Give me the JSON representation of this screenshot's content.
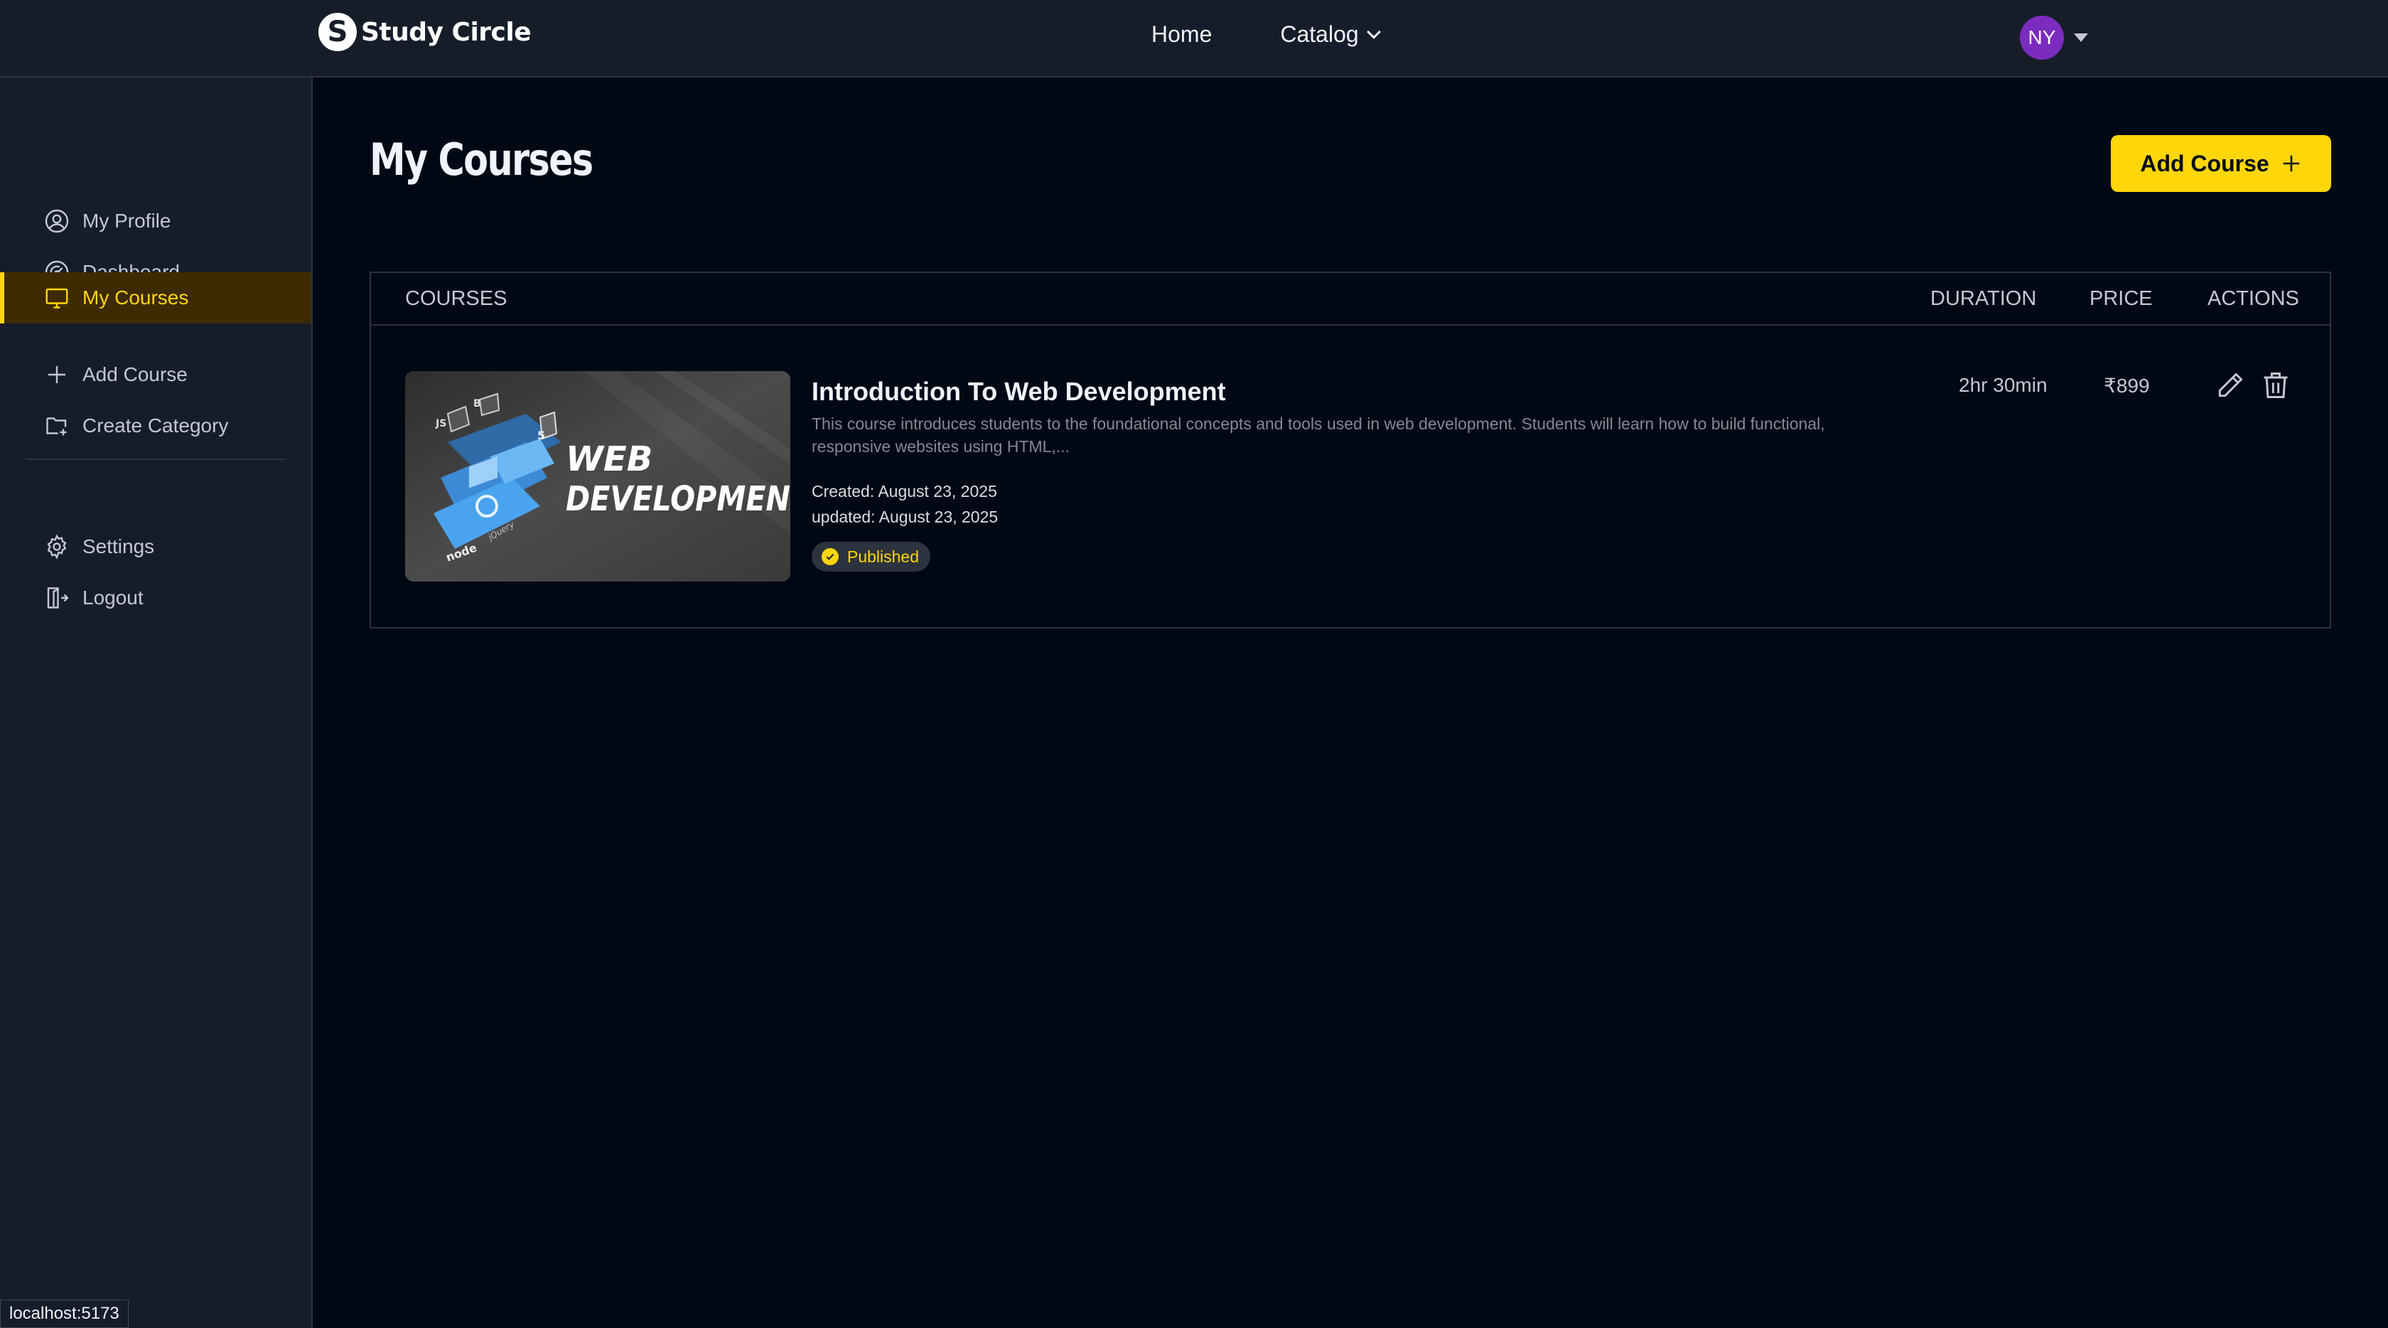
{
  "brand": {
    "name": "Study Circle",
    "mark": "S"
  },
  "nav": {
    "links": [
      {
        "label": "Home",
        "icon": ""
      },
      {
        "label": "Catalog",
        "icon": "chevron-down-icon"
      }
    ],
    "user_initials": "NY",
    "avatar_color": "#7b2cbf"
  },
  "sidebar": {
    "items": [
      {
        "label": "My Profile",
        "icon": "user-circle-icon"
      },
      {
        "label": "Dashboard",
        "icon": "gauge-icon"
      },
      {
        "label": "My Courses",
        "icon": "monitor-icon",
        "active": true
      },
      {
        "label": "Add Course",
        "icon": "plus-icon"
      },
      {
        "label": "Create Category",
        "icon": "folder-plus-icon"
      }
    ],
    "bottom_items": [
      {
        "label": "Settings",
        "icon": "gear-icon"
      },
      {
        "label": "Logout",
        "icon": "logout-icon"
      }
    ]
  },
  "page": {
    "title": "My Courses",
    "add_button": "Add Course",
    "accent": "#ffd60a"
  },
  "table": {
    "headers": {
      "courses": "COURSES",
      "duration": "DURATION",
      "price": "PRICE",
      "actions": "ACTIONS"
    },
    "rows": [
      {
        "title": "Introduction To Web Development",
        "description": "This course introduces students to the foundational concepts and tools used in web development. Students will learn how to build functional, responsive websites using HTML,...",
        "created": "Created: August 23, 2025",
        "updated": "updated: August 23, 2025",
        "status": "Published",
        "duration": "2hr 30min",
        "price": "₹899",
        "thumbnail_text": [
          "WEB",
          "DEVELOPMEN"
        ],
        "thumbnail_tags": [
          "JS",
          "B",
          "5",
          "node",
          "jQuery"
        ]
      }
    ]
  },
  "status_url": "localhost:5173"
}
